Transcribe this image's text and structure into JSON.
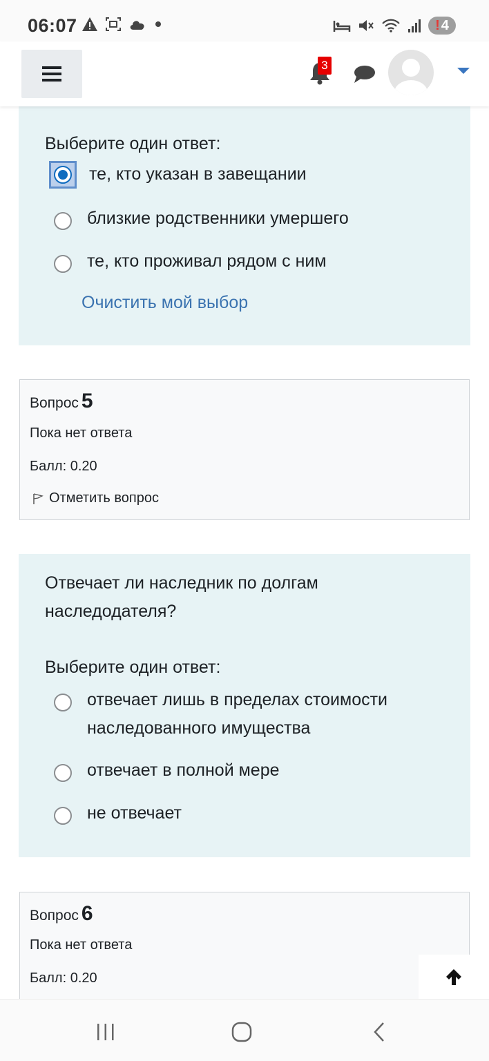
{
  "status_bar": {
    "time": "06:07",
    "left_icons": [
      "warning-icon",
      "screenshot-icon",
      "cloud-icon",
      "dot-icon"
    ],
    "right_icons": [
      "sleep-mode-icon",
      "mute-icon",
      "wifi-icon",
      "signal-icon"
    ],
    "battery_label": "4",
    "battery_alert": "!"
  },
  "header": {
    "menu_icon": "hamburger-icon",
    "notification_count": "3",
    "colors": {
      "accent": "#0f6cbf",
      "badge": "#e60000",
      "link": "#3b73b0",
      "question_bg": "#e7f3f5"
    }
  },
  "question4": {
    "prompt": "Выберите один ответ:",
    "options": [
      {
        "label": "те, кто указан в завещании",
        "checked": true
      },
      {
        "label": "близкие родственники умершего",
        "checked": false
      },
      {
        "label": "те, кто проживал рядом с ним",
        "checked": false
      }
    ],
    "clear_label": "Очистить мой выбор"
  },
  "question5_info": {
    "heading": "Вопрос",
    "number": "5",
    "status": "Пока нет ответа",
    "grade": "Балл: 0.20",
    "flag_label": "Отметить вопрос"
  },
  "question5": {
    "question": "Отвечает ли наследник по долгам наследодателя?",
    "prompt": "Выберите один ответ:",
    "options": [
      {
        "label": "отвечает лишь в пределах стоимости наследованного имущества",
        "checked": false
      },
      {
        "label": "отвечает в полной мере",
        "checked": false
      },
      {
        "label": "не отвечает",
        "checked": false
      }
    ]
  },
  "question6_info": {
    "heading": "Вопрос",
    "number": "6",
    "status": "Пока нет ответа",
    "grade": "Балл: 0.20"
  },
  "nav": {
    "recent_icon": "recent-apps-icon",
    "home_icon": "home-icon",
    "back_icon": "back-icon"
  }
}
